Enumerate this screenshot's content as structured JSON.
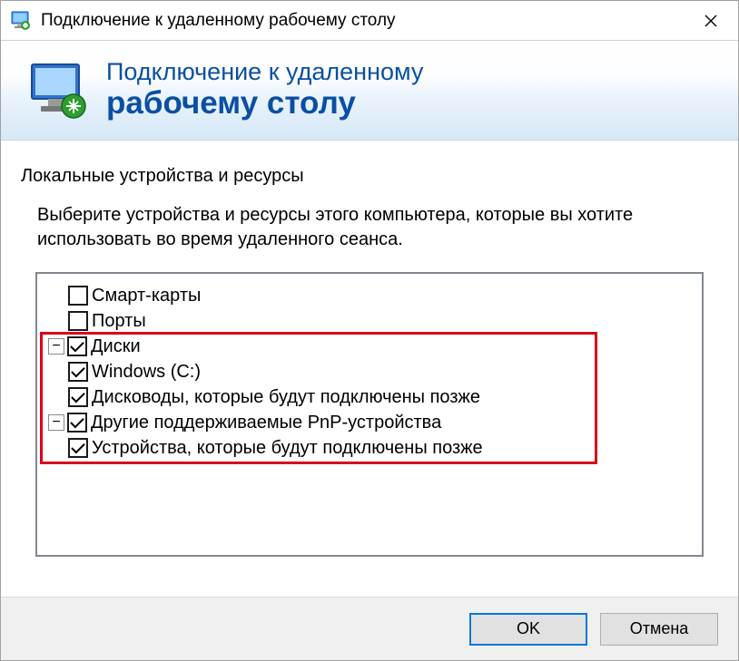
{
  "window": {
    "title": "Подключение к удаленному рабочему столу"
  },
  "banner": {
    "line1": "Подключение к удаленному",
    "line2": "рабочему столу"
  },
  "section": {
    "header": "Локальные устройства и ресурсы",
    "description": "Выберите устройства и ресурсы этого компьютера, которые вы хотите использовать во время удаленного сеанса."
  },
  "tree": {
    "smart_cards": "Смарт-карты",
    "ports": "Порты",
    "drives": "Диски",
    "drive_c": "Windows (C:)",
    "drives_future": "Дисководы, которые будут подключены позже",
    "pnp": "Другие поддерживаемые PnP-устройства",
    "pnp_future": "Устройства, которые будут подключены позже"
  },
  "buttons": {
    "ok": "OK",
    "cancel": "Отмена"
  },
  "glyphs": {
    "minus": "−",
    "close": "✕"
  }
}
